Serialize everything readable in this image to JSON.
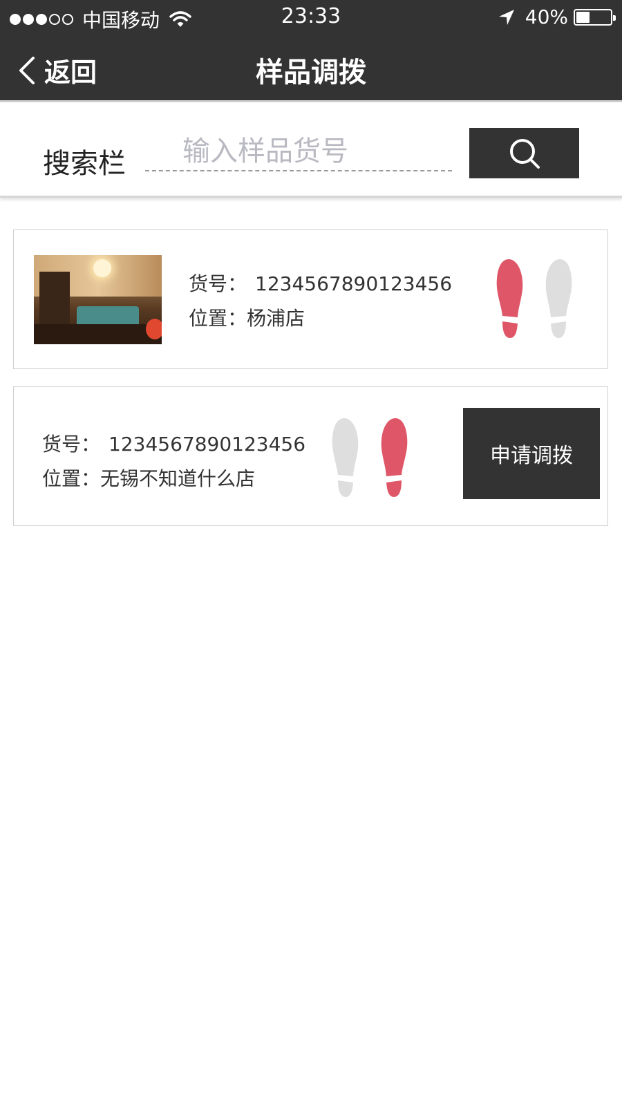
{
  "status_bar": {
    "signal": {
      "filled": 3,
      "total": 5
    },
    "carrier": "中国移动",
    "time": "23:33",
    "battery_percent": "40%",
    "battery_level": 0.4
  },
  "nav": {
    "back_label": "返回",
    "title": "样品调拨"
  },
  "search": {
    "label": "搜索栏",
    "placeholder": "输入样品货号",
    "value": ""
  },
  "items": [
    {
      "code_key": "货号：",
      "code": "1234567890123456",
      "location_key": "位置：",
      "location": "杨浦店",
      "left_foot": "active",
      "right_foot": "inactive"
    },
    {
      "code_key": "货号：",
      "code": "1234567890123456",
      "location_key": "位置：",
      "location": "无锡不知道什么店",
      "left_foot": "inactive",
      "right_foot": "active",
      "action_label": "申请调拨"
    }
  ],
  "colors": {
    "bar": "#333333",
    "footprint_active": "#de5667",
    "footprint_inactive": "#dedede",
    "placeholder": "#b9b9c2"
  },
  "icons": [
    "wifi-icon",
    "location-arrow-icon",
    "battery-icon",
    "chevron-left-icon",
    "search-icon",
    "footprint-left-icon",
    "footprint-right-icon"
  ]
}
